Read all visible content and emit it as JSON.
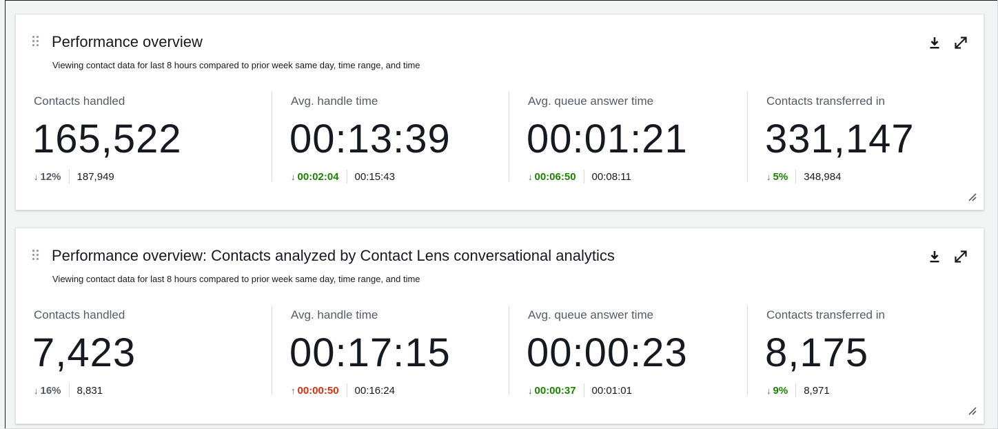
{
  "colors": {
    "good": "#1d8102",
    "bad": "#d13212",
    "neutral": "#545b64"
  },
  "widgets": [
    {
      "title": "Performance overview",
      "subtitle": "Viewing contact data for last 8 hours compared to prior week same day, time range, and time",
      "icons": {
        "drag": "drag-handle-icon",
        "download": "download-icon",
        "expand": "expand-icon",
        "resize": "resize-handle-icon"
      },
      "metrics": [
        {
          "label": "Contacts handled",
          "value": "165,522",
          "arrow": "↓",
          "delta": "12%",
          "trend": "neutral",
          "prior": "187,949"
        },
        {
          "label": "Avg. handle time",
          "value": "00:13:39",
          "arrow": "↓",
          "delta": "00:02:04",
          "trend": "good",
          "prior": "00:15:43"
        },
        {
          "label": "Avg. queue answer time",
          "value": "00:01:21",
          "arrow": "↓",
          "delta": "00:06:50",
          "trend": "good",
          "prior": "00:08:11"
        },
        {
          "label": "Contacts transferred in",
          "value": "331,147",
          "arrow": "↓",
          "delta": "5%",
          "trend": "good",
          "prior": "348,984"
        }
      ]
    },
    {
      "title": "Performance overview: Contacts analyzed by Contact Lens conversational analytics",
      "subtitle": "Viewing contact data for last 8 hours compared to prior week same day, time range, and time",
      "icons": {
        "drag": "drag-handle-icon",
        "download": "download-icon",
        "expand": "expand-icon",
        "resize": "resize-handle-icon"
      },
      "metrics": [
        {
          "label": "Contacts handled",
          "value": "7,423",
          "arrow": "↓",
          "delta": "16%",
          "trend": "neutral",
          "prior": "8,831"
        },
        {
          "label": "Avg. handle time",
          "value": "00:17:15",
          "arrow": "↑",
          "delta": "00:00:50",
          "trend": "bad",
          "prior": "00:16:24"
        },
        {
          "label": "Avg. queue answer time",
          "value": "00:00:23",
          "arrow": "↓",
          "delta": "00:00:37",
          "trend": "good",
          "prior": "00:01:01"
        },
        {
          "label": "Contacts transferred in",
          "value": "8,175",
          "arrow": "↓",
          "delta": "9%",
          "trend": "good",
          "prior": "8,971"
        }
      ]
    }
  ]
}
